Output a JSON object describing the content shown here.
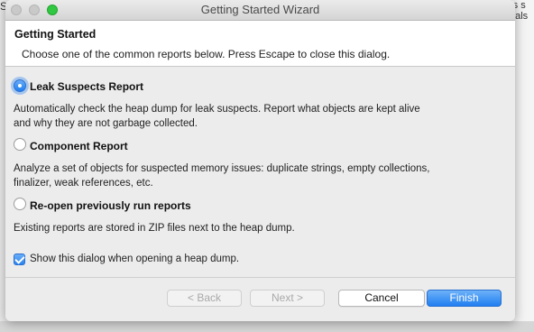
{
  "background": {
    "left_text": "S",
    "right_text": "rs s\nrials"
  },
  "window": {
    "title": "Getting Started Wizard"
  },
  "header": {
    "title": "Getting Started",
    "description": "Choose one of the common reports below. Press Escape to close this dialog."
  },
  "options": [
    {
      "label": "Leak Suspects Report",
      "selected": true,
      "description": "Automatically check the heap dump for leak suspects. Report what objects are kept alive and why they are not garbage collected."
    },
    {
      "label": "Component Report",
      "selected": false,
      "description": "Analyze a set of objects for suspected memory issues: duplicate strings, empty collections, finalizer, weak references, etc."
    },
    {
      "label": "Re-open previously run reports",
      "selected": false,
      "description": "Existing reports are stored in ZIP files next to the heap dump."
    }
  ],
  "show_dialog": {
    "label": "Show this dialog when opening a heap dump.",
    "checked": true
  },
  "buttons": {
    "back": "< Back",
    "next": "Next >",
    "cancel": "Cancel",
    "finish": "Finish"
  },
  "colors": {
    "accent": "#1f7ef0",
    "window_bg": "#ececec"
  }
}
